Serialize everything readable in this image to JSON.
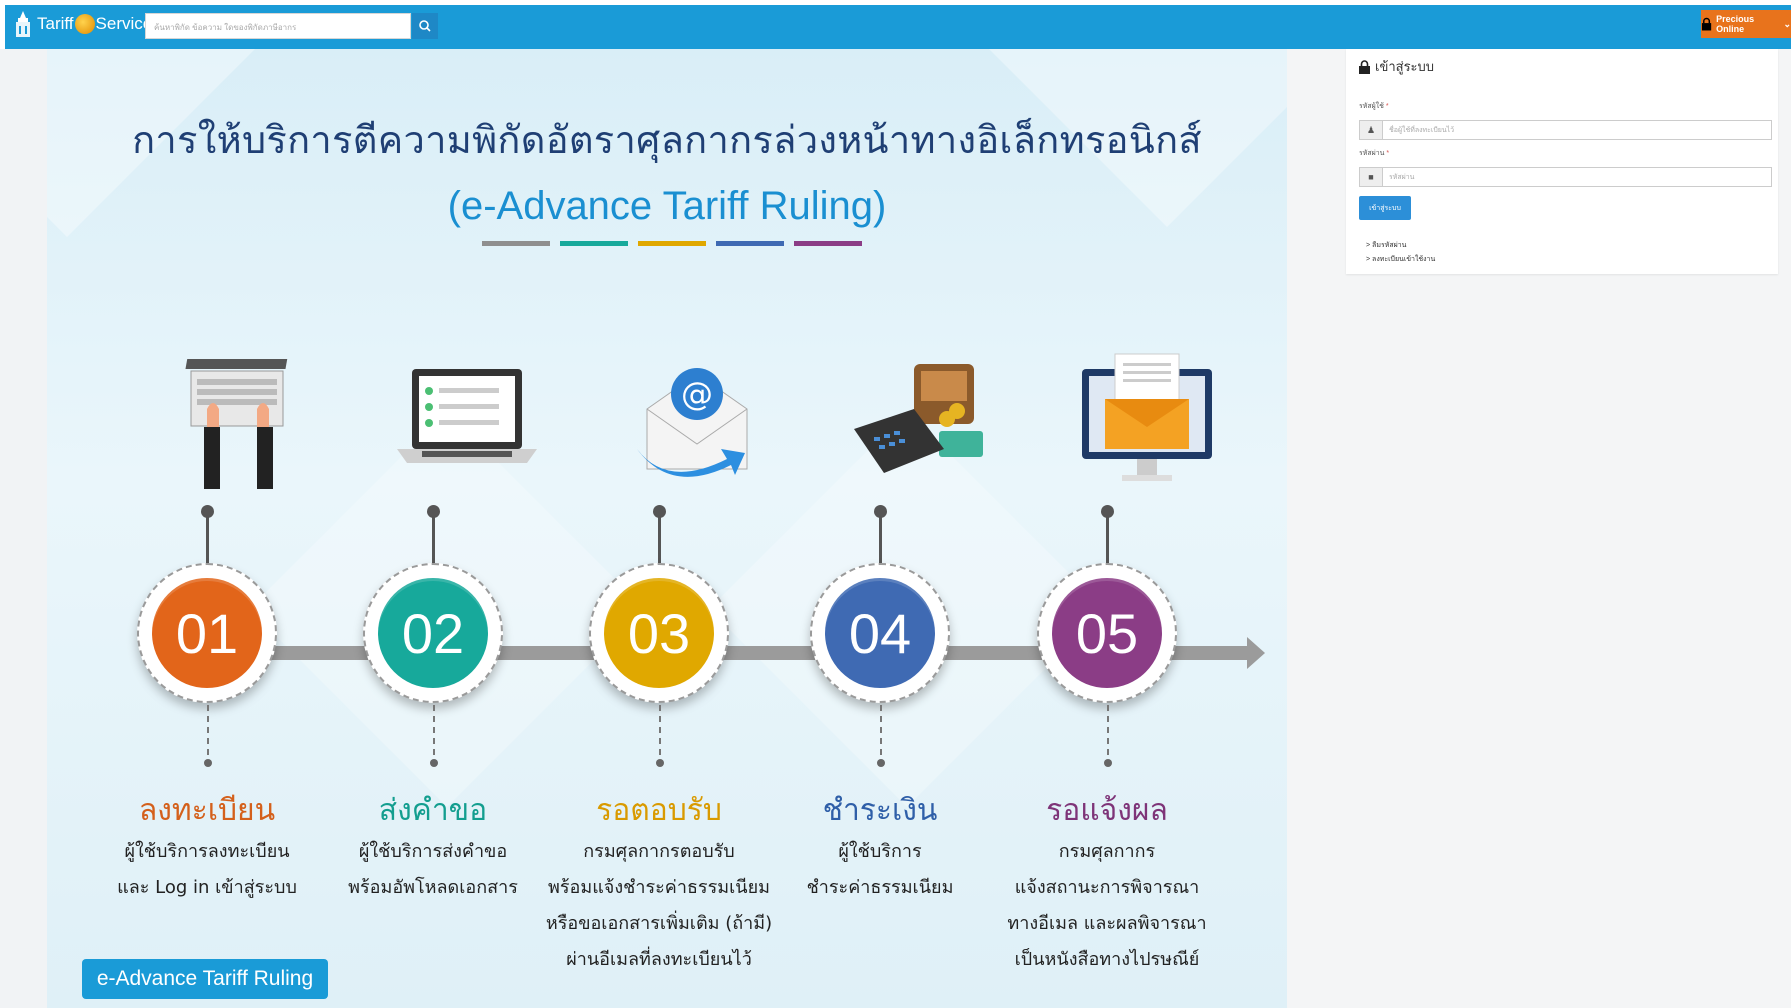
{
  "header": {
    "brand_left": "Tariff",
    "brand_right": "Service",
    "search_placeholder": "ค้นหาพิกัด ข้อความ ใดของพิกัดภาษีอากร",
    "precious_label": "Precious Online"
  },
  "banner": {
    "title": "การให้บริการตีความพิกัดอัตราศุลกากรล่วงหน้าทางอิเล็กทรอนิกส์",
    "subtitle": "(e-Advance Tariff Ruling)",
    "steps": [
      {
        "number": "01",
        "title": "ลงทะเบียน",
        "lines": [
          "ผู้ใช้บริการลงทะเบียน",
          "และ Log in เข้าสู่ระบบ"
        ],
        "cta": "e-Advance Tariff Ruling",
        "color": "#e2651a",
        "title_color": "#d4601b"
      },
      {
        "number": "02",
        "title": "ส่งคำขอ",
        "lines": [
          "ผู้ใช้บริการส่งคำขอ",
          "พร้อมอัพโหลดเอกสาร"
        ],
        "color": "#17a99b",
        "title_color": "#139e8f"
      },
      {
        "number": "03",
        "title": "รอตอบรับ",
        "lines": [
          "กรมศุลกากรตอบรับ",
          "พร้อมแจ้งชำระค่าธรรมเนียม",
          "หรือขอเอกสารเพิ่มเติม (ถ้ามี)",
          "ผ่านอีเมลที่ลงทะเบียนไว้"
        ],
        "color": "#e0a800",
        "title_color": "#d99a00"
      },
      {
        "number": "04",
        "title": "ชำระเงิน",
        "lines": [
          "ผู้ใช้บริการ",
          "ชำระค่าธรรมเนียม"
        ],
        "color": "#3f6ab3",
        "title_color": "#2f5fa8"
      },
      {
        "number": "05",
        "title": "รอแจ้งผล",
        "lines": [
          "กรมศุลกากร",
          "แจ้งสถานะการพิจารณา",
          "ทางอีเมล และผลพิจารณา",
          "เป็นหนังสือทางไปรษณีย์"
        ],
        "color": "#8b3d86",
        "title_color": "#7e3478"
      }
    ]
  },
  "login": {
    "heading": "เข้าสู่ระบบ",
    "username_label": "รหัสผู้ใช้",
    "username_placeholder": "ชื่อผู้ใช้ที่ลงทะเบียนไว้",
    "password_label": "รหัสผ่าน",
    "password_placeholder": "รหัสผ่าน",
    "submit_label": "เข้าสู่ระบบ",
    "links": [
      "ลืมรหัสผ่าน",
      "ลงทะเบียนเข้าใช้งาน"
    ]
  },
  "colors": {
    "topbar": "#1a9bd7",
    "precious": "#e8731c",
    "bar_colors": [
      "#8f8f8f",
      "#17a99b",
      "#e0a800",
      "#3f6ab3",
      "#8b3d86"
    ]
  }
}
